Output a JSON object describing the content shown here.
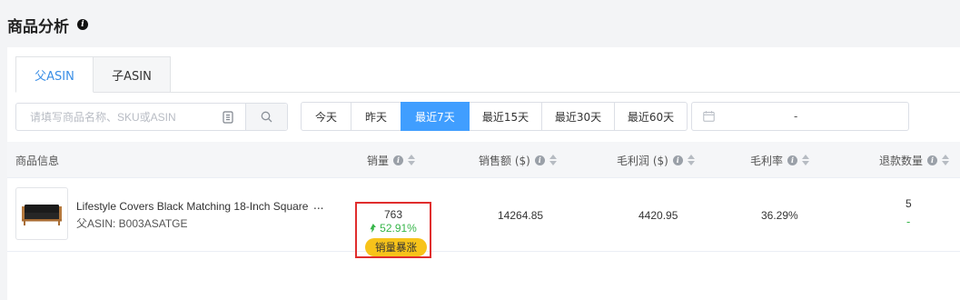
{
  "page": {
    "title": "商品分析"
  },
  "tabs": [
    {
      "label": "父ASIN",
      "active": true
    },
    {
      "label": "子ASIN",
      "active": false
    }
  ],
  "search": {
    "placeholder": "请填写商品名称、SKU或ASIN",
    "value": ""
  },
  "date_filters": [
    {
      "label": "今天",
      "active": false
    },
    {
      "label": "昨天",
      "active": false
    },
    {
      "label": "最近7天",
      "active": true
    },
    {
      "label": "最近15天",
      "active": false
    },
    {
      "label": "最近30天",
      "active": false
    },
    {
      "label": "最近60天",
      "active": false
    }
  ],
  "date_range": {
    "separator": "-"
  },
  "table": {
    "headers": {
      "product_info": "商品信息",
      "sales_qty": "销量",
      "sales_amount": "销售额 ($)",
      "gross_profit": "毛利润 ($)",
      "gross_margin": "毛利率",
      "refund_qty": "退款数量"
    },
    "rows": [
      {
        "title": "Lifestyle Covers Black Matching 18-Inch Square",
        "ellipsis": "...",
        "asin_label": "父ASIN: B003ASATGE",
        "sales_qty": "763",
        "sales_growth": "52.91%",
        "sales_badge": "销量暴涨",
        "sales_amount": "14264.85",
        "gross_profit": "4420.95",
        "gross_margin": "36.29%",
        "refund_qty": "5",
        "refund_change": "-"
      }
    ]
  },
  "colors": {
    "accent": "#409eff",
    "growth_green": "#37b64a",
    "badge_yellow": "#f7c31a",
    "highlight_red": "#e02d2d"
  },
  "icons": [
    "info-icon",
    "scan-icon",
    "search-icon",
    "calendar-icon",
    "sort-icon",
    "growth-arrow-icon",
    "sofa-product-image"
  ]
}
